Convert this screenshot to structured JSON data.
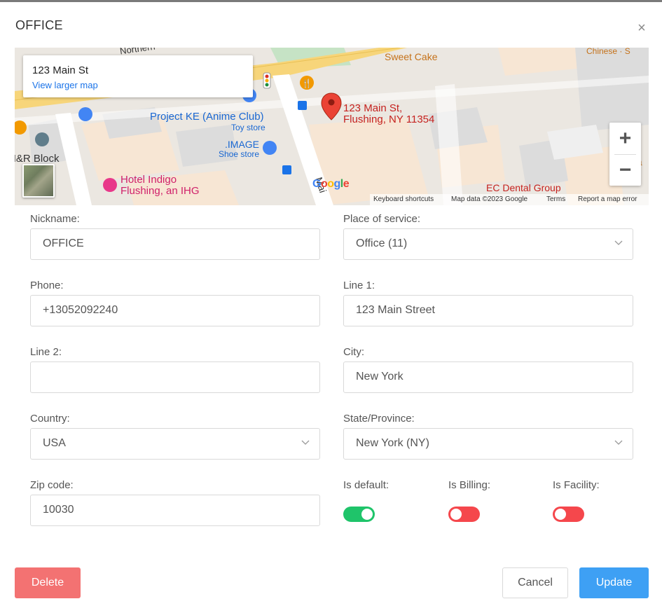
{
  "dialog": {
    "title": "OFFICE",
    "close_label": "×"
  },
  "map": {
    "infocard": {
      "address": "123 Main St",
      "link": "View larger map"
    },
    "marker_label_line1": "123 Main St,",
    "marker_label_line2": "Flushing, NY 11354",
    "pois": {
      "sweet_cake": "Sweet Cake",
      "chinese": "Chinese · S",
      "northern": "Northern",
      "project_ke": "Project KE (Anime Club)",
      "toy_store": "Toy store",
      "image_store": ".IMAGE",
      "shoe_store": "Shoe store",
      "hr_block": "H&R Block",
      "hotel_indigo_line1": "Hotel Indigo",
      "hotel_indigo_line2": "Flushing, an IHG",
      "ec_dental": "EC Dental Group",
      "main_street_fragment": "Mai",
      "right_edge_fragment": "La"
    },
    "zoom_in": "+",
    "zoom_out": "−",
    "google_logo": "Google",
    "footer": {
      "shortcuts": "Keyboard shortcuts",
      "map_data": "Map data ©2023 Google",
      "terms": "Terms",
      "report": "Report a map error"
    }
  },
  "form": {
    "nickname": {
      "label": "Nickname:",
      "value": "OFFICE"
    },
    "place_of_service": {
      "label": "Place of service:",
      "value": "Office (11)"
    },
    "phone": {
      "label": "Phone:",
      "value": "+13052092240"
    },
    "line1": {
      "label": "Line 1:",
      "value": "123 Main Street"
    },
    "line2": {
      "label": "Line 2:",
      "value": ""
    },
    "city": {
      "label": "City:",
      "value": "New York"
    },
    "country": {
      "label": "Country:",
      "value": "USA"
    },
    "state": {
      "label": "State/Province:",
      "value": "New York (NY)"
    },
    "zip": {
      "label": "Zip code:",
      "value": "10030"
    },
    "is_default": {
      "label": "Is default:",
      "on": true
    },
    "is_billing": {
      "label": "Is Billing:",
      "on": false
    },
    "is_facility": {
      "label": "Is Facility:",
      "on": false
    }
  },
  "actions": {
    "delete": "Delete",
    "cancel": "Cancel",
    "update": "Update"
  },
  "colors": {
    "toggle_on": "#1fc46a",
    "toggle_off": "#f5474c",
    "delete": "#f37272",
    "update": "#3ea0f4"
  }
}
